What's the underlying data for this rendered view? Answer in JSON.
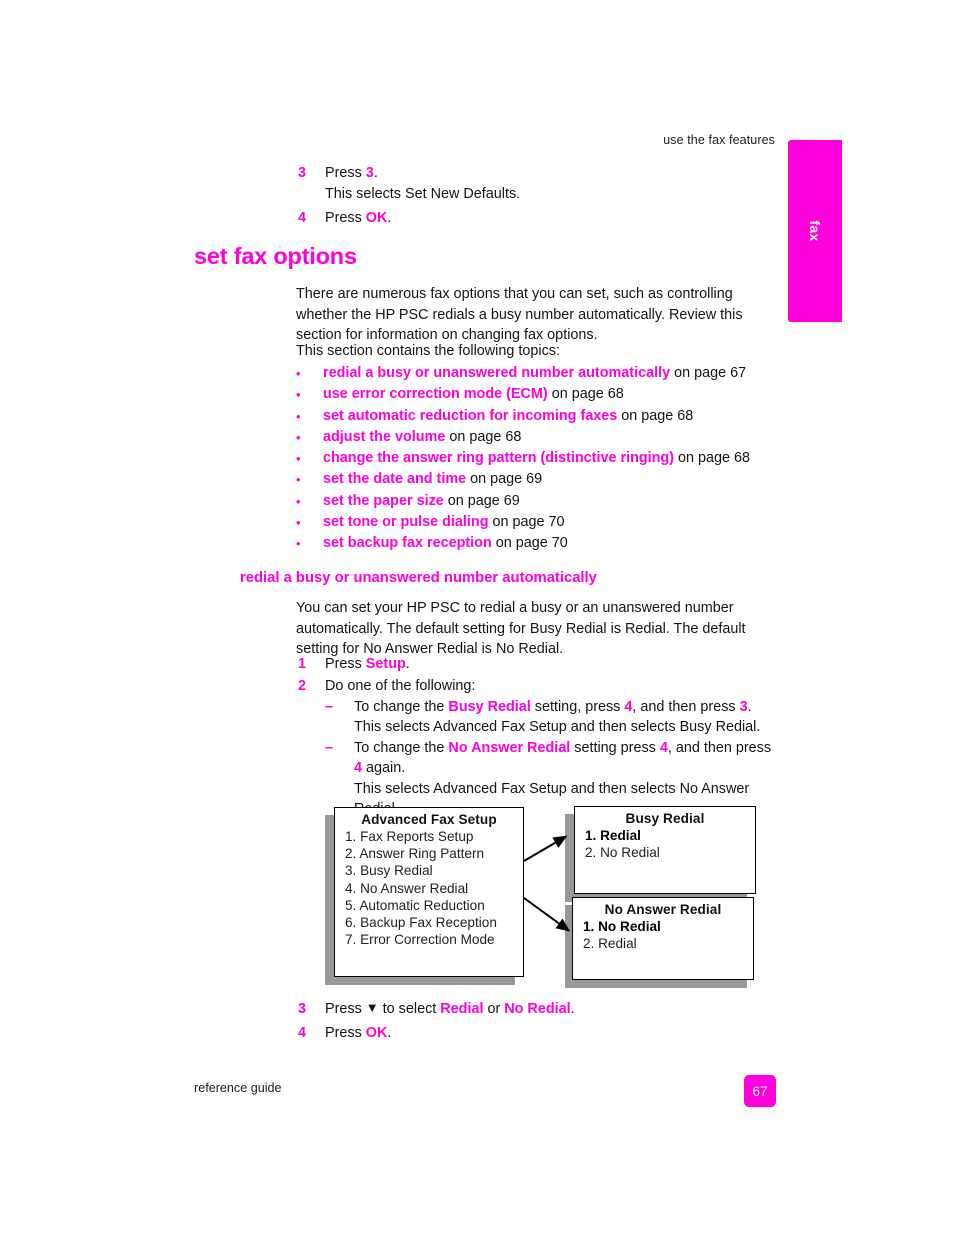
{
  "header": {
    "running_head": "use the fax features"
  },
  "thumb_tab": {
    "label": "fax",
    "color": "#ff00dc"
  },
  "top_steps": [
    {
      "num": "3",
      "lines": [
        {
          "prefix": "Press ",
          "emph": "3",
          "suffix": "."
        },
        {
          "plain": "This selects Set New Defaults."
        }
      ]
    },
    {
      "num": "4",
      "lines": [
        {
          "prefix": "Press ",
          "emph": "OK",
          "suffix": "."
        }
      ]
    }
  ],
  "section": {
    "heading": "set fax options",
    "intro": "There are numerous fax options that you can set, such as controlling whether the HP PSC redials a busy number automatically. Review this section for information on changing fax options.",
    "toc_lead": "This section contains the following topics:",
    "topics": [
      {
        "link": "redial a busy or unanswered number automatically",
        "ref": " on page 67"
      },
      {
        "link": "use error correction mode (ECM)",
        "ref": " on page 68"
      },
      {
        "link": "set automatic reduction for incoming faxes",
        "ref": " on page 68"
      },
      {
        "link": "adjust the volume",
        "ref": " on page 68"
      },
      {
        "link": "change the answer ring pattern (distinctive ringing)",
        "ref": " on page 68"
      },
      {
        "link": "set the date and time",
        "ref": " on page 69"
      },
      {
        "link": "set the paper size",
        "ref": " on page 69"
      },
      {
        "link": "set tone or pulse dialing",
        "ref": " on page 70"
      },
      {
        "link": "set backup fax reception",
        "ref": " on page 70"
      }
    ]
  },
  "subsection": {
    "heading": "redial a busy or unanswered number automatically",
    "intro": "You can set your HP PSC to redial a busy or an unanswered number automatically. The default setting for Busy Redial is Redial. The default setting for No Answer Redial is No Redial.",
    "step1": {
      "num": "1",
      "prefix": "Press ",
      "emph": "Setup",
      "suffix": "."
    },
    "step2": {
      "num": "2",
      "lead": "Do one of the following:",
      "dash_mark": "–",
      "items": [
        {
          "t1": "To change the ",
          "e1": "Busy Redial",
          "t2": " setting, press ",
          "e2": "4",
          "t3": ", and then press ",
          "e3": "3",
          "t4": ".",
          "note": "This selects Advanced Fax Setup and then selects Busy Redial."
        },
        {
          "t1": "To change the ",
          "e1": "No Answer Redial",
          "t2": " setting press ",
          "e2": "4",
          "t3": ", and then press ",
          "e3": "4",
          "t4": " again.",
          "note": "This selects Advanced Fax Setup and then selects No Answer Redial."
        }
      ]
    },
    "step3": {
      "num": "3",
      "prefix": "Press ",
      "arrow_glyph": "▼",
      "mid": " to select ",
      "emph1": "Redial",
      "or": " or ",
      "emph2": "No Redial",
      "suffix": "."
    },
    "step4": {
      "num": "4",
      "prefix": "Press ",
      "emph": "OK",
      "suffix": "."
    }
  },
  "diagram": {
    "boxes": [
      {
        "name": "advanced-fax-setup",
        "title": "Advanced Fax Setup",
        "items": [
          {
            "text": "1. Fax Reports Setup",
            "selected": false
          },
          {
            "text": "2. Answer Ring Pattern",
            "selected": false
          },
          {
            "text": "3. Busy Redial",
            "selected": false
          },
          {
            "text": "4. No Answer Redial",
            "selected": false
          },
          {
            "text": "5. Automatic Reduction",
            "selected": false
          },
          {
            "text": "6. Backup Fax Reception",
            "selected": false
          },
          {
            "text": "7. Error Correction Mode",
            "selected": false
          }
        ]
      },
      {
        "name": "busy-redial",
        "title": "Busy Redial",
        "items": [
          {
            "text": "1. Redial",
            "selected": true
          },
          {
            "text": "2. No Redial",
            "selected": false
          }
        ]
      },
      {
        "name": "no-answer-redial",
        "title": "No Answer Redial",
        "items": [
          {
            "text": "1. No Redial",
            "selected": true
          },
          {
            "text": "2. Redial",
            "selected": false
          }
        ]
      }
    ]
  },
  "footer": {
    "label": "reference guide",
    "page_number": "67"
  }
}
